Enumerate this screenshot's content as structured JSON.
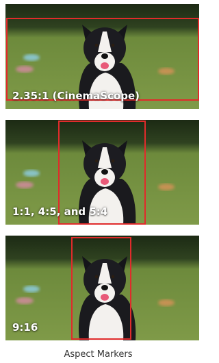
{
  "panels": [
    {
      "label": "2.35:1 (CinemaScope)"
    },
    {
      "label": "1:1, 4:5, and 5:4"
    },
    {
      "label": "9:16"
    }
  ],
  "caption": "Aspect Markers",
  "colors": {
    "marker": "#e02b2b",
    "grass": "#6f8a3a",
    "trees": "#223319",
    "label_text": "#ffffff"
  }
}
